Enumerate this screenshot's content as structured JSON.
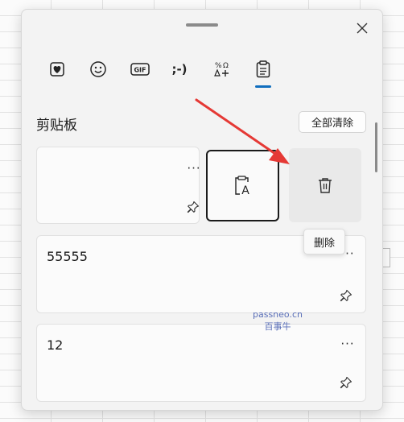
{
  "panel": {
    "section_title": "剪贴板",
    "clear_all_label": "全部清除"
  },
  "tabs": [
    {
      "name": "favorites-heart-icon"
    },
    {
      "name": "emoji-smiley-icon"
    },
    {
      "name": "gif-icon",
      "label": "GIF"
    },
    {
      "name": "kaomoji-icon",
      "label": ";-)"
    },
    {
      "name": "symbols-icon"
    },
    {
      "name": "clipboard-icon",
      "selected": true
    }
  ],
  "items": [
    {
      "text": "",
      "more": "···"
    },
    {
      "text": "55555",
      "more": "···"
    },
    {
      "text": "12",
      "more": "···"
    }
  ],
  "tooltip": {
    "label": "删除"
  },
  "watermark": {
    "line1": "passneo.cn",
    "line2": "百事牛"
  },
  "colors": {
    "accent": "#106ebe",
    "arrow": "#e53935",
    "panel_bg": "#f3f3f3"
  }
}
